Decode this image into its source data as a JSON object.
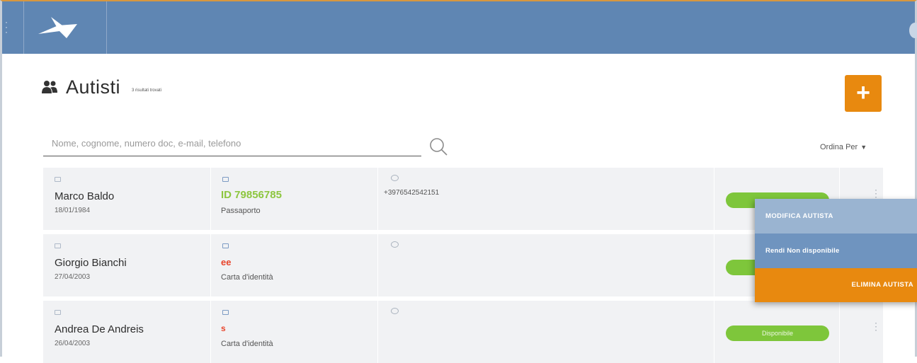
{
  "header": {
    "menu_icon": "kebab-vertical-icon",
    "logo_icon": "bird-arrow-logo"
  },
  "page": {
    "title": "Autisti",
    "subtitle": "3 risultati trovati",
    "title_icon": "users-icon",
    "add_button_label": "+"
  },
  "search": {
    "placeholder": "Nome, cognome, numero doc, e-mail, telefono",
    "value": "",
    "icon": "search-icon"
  },
  "sort": {
    "label": "Ordina Per",
    "caret": "▼"
  },
  "rows": [
    {
      "name": "Marco Baldo",
      "birthdate": "18/01/1984",
      "doc_number": "ID 79856785",
      "doc_type": "Passaporto",
      "phone": "+39765425421​51",
      "status": "",
      "kebab": "⋮"
    },
    {
      "name": "Giorgio Bianchi",
      "birthdate": "27/04/2003",
      "doc_number": "ee",
      "doc_type": "Carta d'identità",
      "phone": "",
      "status": "",
      "kebab": "⋮"
    },
    {
      "name": "Andrea De Andreis",
      "birthdate": "26/04/2003",
      "doc_number": "s",
      "doc_type": "Carta d'identità",
      "phone": "",
      "status": "Disponibile",
      "kebab": "⋮"
    }
  ],
  "context_menu": {
    "edit": "MODIFICA AUTISTA",
    "set_unavailable": "Rendi Non disponibile",
    "delete": "ELIMINA AUTISTA"
  },
  "colors": {
    "topbar": "#5f86b3",
    "accent_orange": "#e8890f",
    "status_green": "#7ec63b",
    "doc_green": "#8dc63f",
    "doc_red": "#e8452c"
  }
}
